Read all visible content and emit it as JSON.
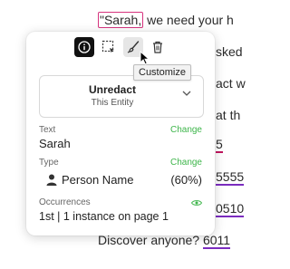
{
  "document": {
    "line1_quote": "\"Sarah,",
    "line1_rest": " we need your h",
    "line2": "sked",
    "line3": "act w",
    "line4": "at th",
    "line5": "5",
    "line6": "5555",
    "line7": "0510",
    "line8_prefix": "Discover anyone? ",
    "line8_num": "6011"
  },
  "toolbar": {
    "info_icon": "info-icon",
    "select_icon": "dashed-select-icon",
    "brush_icon": "brush-icon",
    "trash_icon": "trash-icon",
    "tooltip": "Customize"
  },
  "unredact": {
    "title": "Unredact",
    "subtitle": "This Entity"
  },
  "text_section": {
    "label": "Text",
    "change": "Change",
    "value": "Sarah"
  },
  "type_section": {
    "label": "Type",
    "change": "Change",
    "value": "Person Name",
    "confidence": "(60%)"
  },
  "occurrences": {
    "label": "Occurrences",
    "value": "1st | 1 instance on page 1"
  },
  "colors": {
    "accent_green": "#3db54a",
    "highlight_pink": "#d6337e",
    "active_button": "#111111"
  }
}
